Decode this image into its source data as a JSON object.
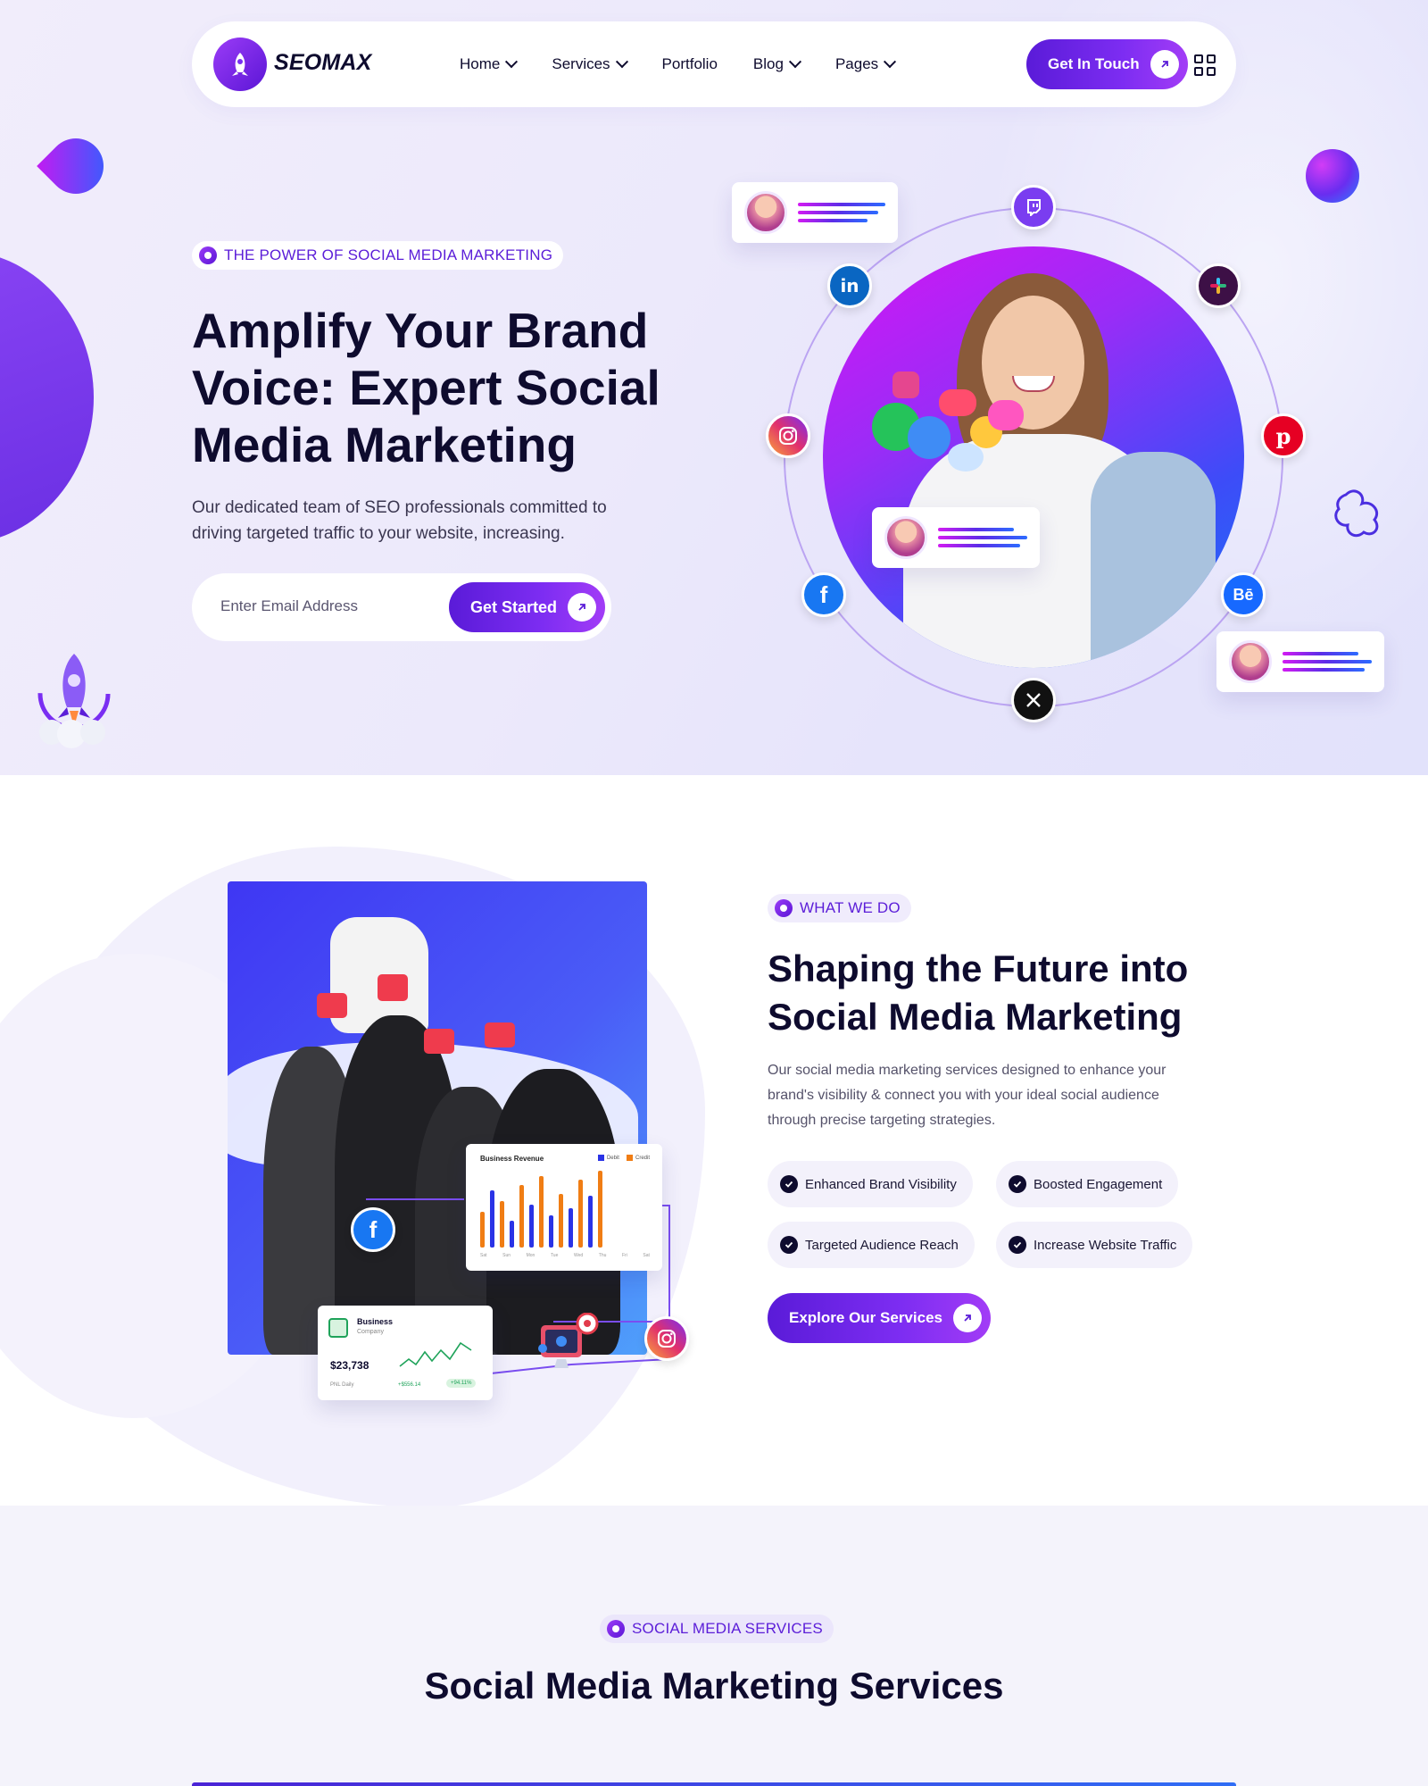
{
  "nav": {
    "brand": "SEOMAX",
    "items": [
      {
        "label": "Home",
        "dropdown": true
      },
      {
        "label": "Services",
        "dropdown": true
      },
      {
        "label": "Portfolio",
        "dropdown": false
      },
      {
        "label": "Blog",
        "dropdown": true
      },
      {
        "label": "Pages",
        "dropdown": true
      }
    ],
    "cta": "Get In Touch"
  },
  "hero": {
    "tag": "THE POWER OF SOCIAL MEDIA MARKETING",
    "title": "Amplify Your Brand Voice: Expert Social Media Marketing",
    "description": "Our dedicated team of SEO professionals committed to driving targeted traffic to your website, increasing.",
    "email_placeholder": "Enter Email Address",
    "cta": "Get Started",
    "social_icons": [
      "twitch-icon",
      "linkedin-icon",
      "slack-icon",
      "instagram-icon",
      "pinterest-icon",
      "facebook-icon",
      "behance-icon",
      "x-icon"
    ]
  },
  "about": {
    "tag": "WHAT WE DO",
    "title": "Shaping the Future into Social Media Marketing",
    "description": "Our social media marketing services designed to enhance your brand's visibility & connect you with your ideal social audience through precise targeting strategies.",
    "features": [
      "Enhanced Brand Visibility",
      "Boosted Engagement",
      "Targeted Audience Reach",
      "Increase Website Traffic"
    ],
    "cta": "Explore Our Services",
    "revenue_card": {
      "title": "Business Revenue",
      "legend": [
        "Debit",
        "Credit"
      ],
      "days": [
        "Sat",
        "Sun",
        "Mon",
        "Tue",
        "Wed",
        "Thu",
        "Fri",
        "Sat"
      ]
    },
    "pnl_card": {
      "name": "Business",
      "sub": "Company",
      "value": "$23,738",
      "label": "PNL Daily",
      "change": "+$556.14",
      "badge": "+94.11%"
    }
  },
  "services": {
    "tag": "SOCIAL MEDIA SERVICES",
    "title": "Social Media Marketing Services"
  },
  "colors": {
    "accent": "#5b1dd8",
    "accent_light": "#a23cf6",
    "dark": "#0e0b2e",
    "debit": "#2a33e6",
    "credit": "#f07d14"
  }
}
